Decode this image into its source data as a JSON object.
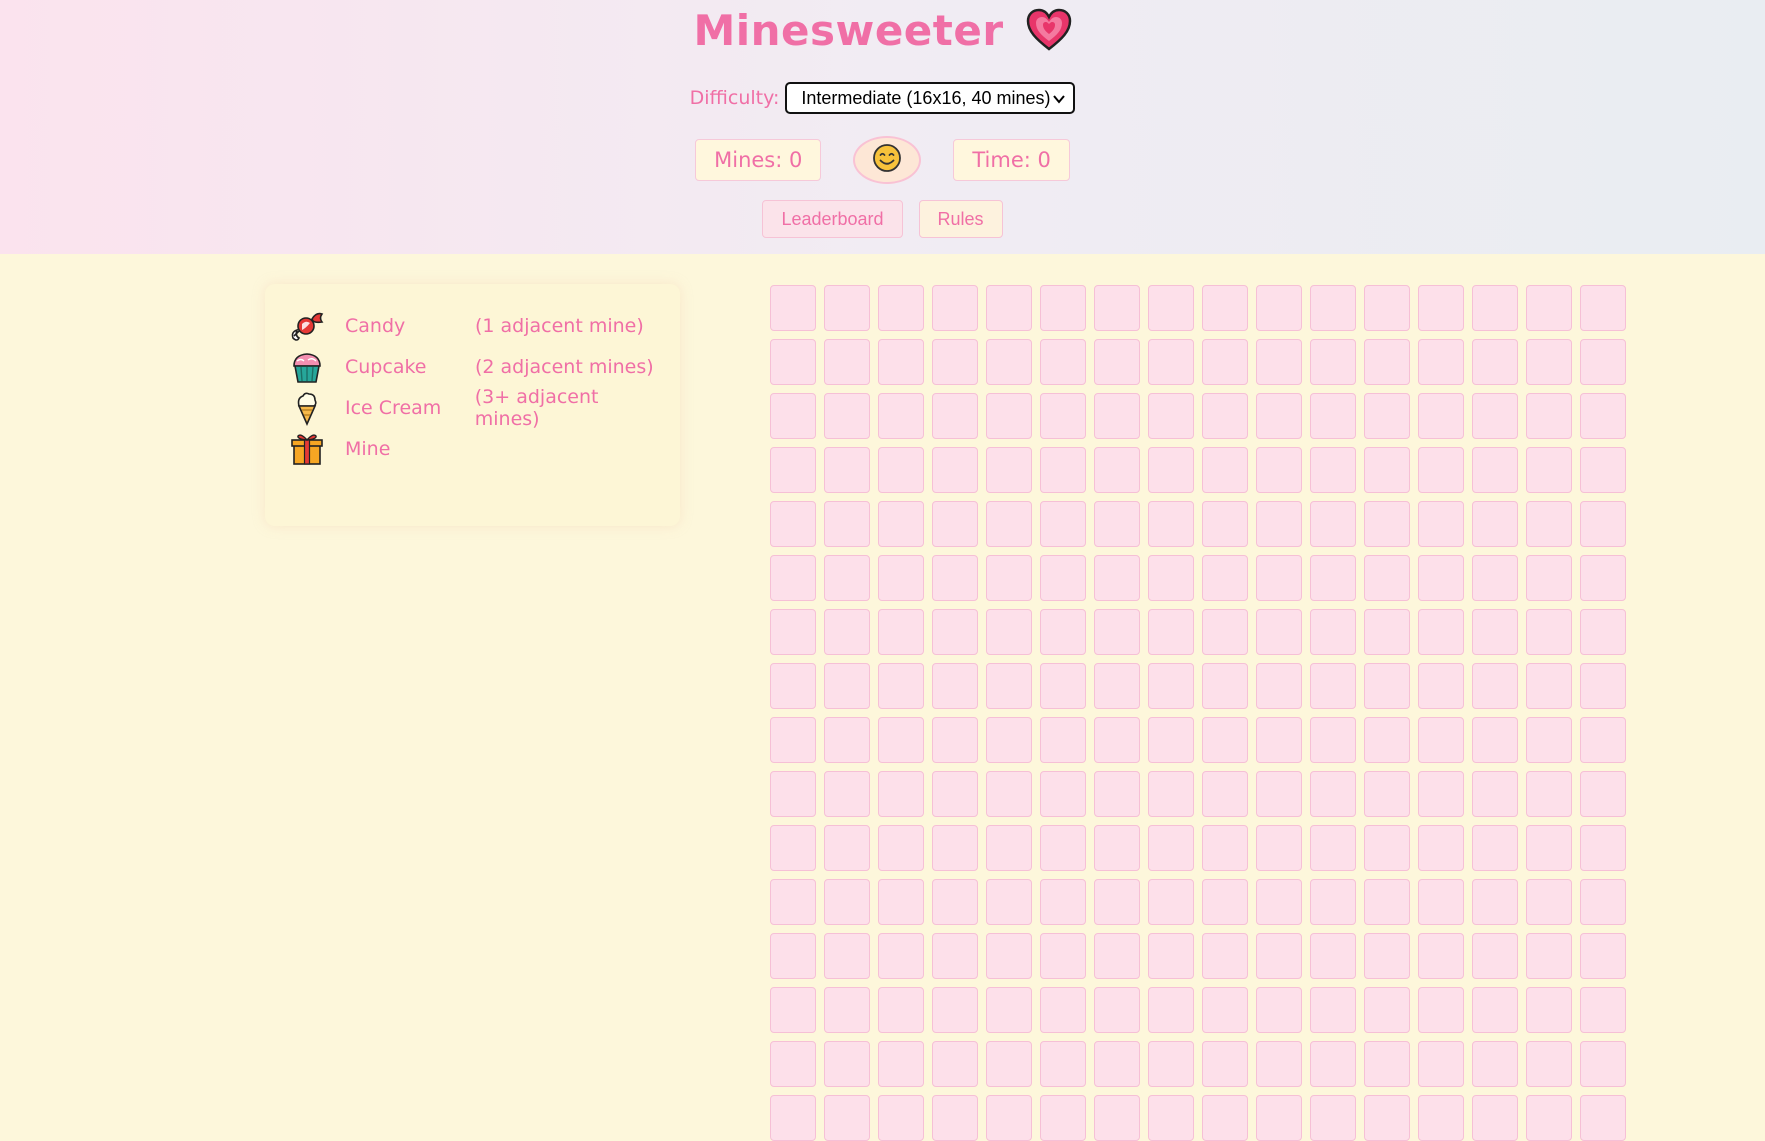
{
  "header": {
    "title": "Minesweeter",
    "difficulty_label": "Difficulty:",
    "difficulty_value": "Intermediate (16x16, 40 mines)",
    "mines_text": "Mines: 0",
    "time_text": "Time: 0",
    "leaderboard_label": "Leaderboard",
    "rules_label": "Rules"
  },
  "legend": {
    "items": [
      {
        "icon": "candy-icon",
        "name": "Candy",
        "desc": "(1 adjacent mine)"
      },
      {
        "icon": "cupcake-icon",
        "name": "Cupcake",
        "desc": "(2 adjacent mines)"
      },
      {
        "icon": "ice-cream-icon",
        "name": "Ice Cream",
        "desc": "(3+ adjacent mines)"
      },
      {
        "icon": "gift-icon",
        "name": "Mine",
        "desc": ""
      }
    ]
  },
  "board": {
    "columns": 16,
    "rows": 16,
    "cell_state": "unrevealed"
  },
  "colors": {
    "accent": "#f06fa6",
    "cell_fill": "#fde0ea",
    "cell_border": "#f6c0d6",
    "page_background": "#fdf7db"
  }
}
